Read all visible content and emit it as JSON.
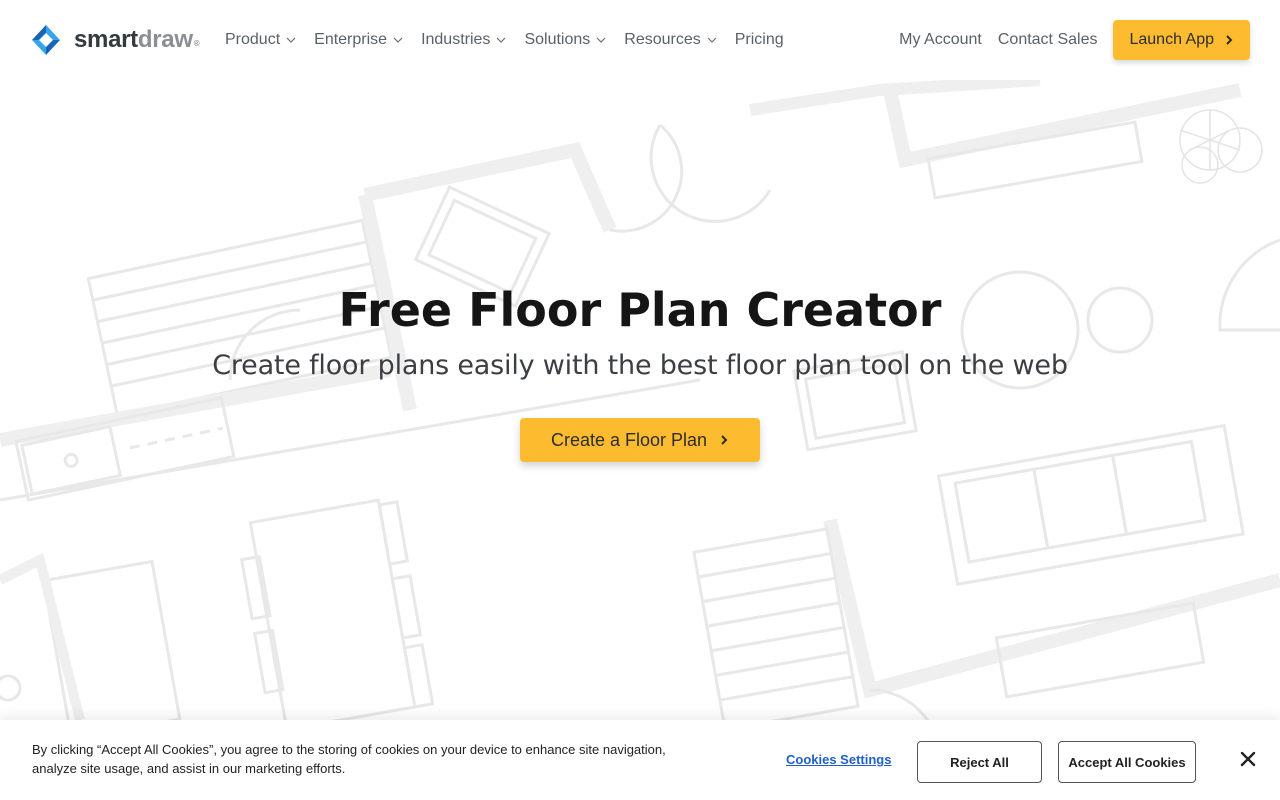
{
  "brand": {
    "name_part1": "smart",
    "name_part2": "draw",
    "trademark": "®",
    "colors": {
      "dark": "#333a40",
      "gray": "#8a8f94",
      "blue_light": "#34a6e8",
      "blue_dark": "#1764b8"
    }
  },
  "nav": {
    "items": [
      {
        "label": "Product",
        "has_dropdown": true
      },
      {
        "label": "Enterprise",
        "has_dropdown": true
      },
      {
        "label": "Industries",
        "has_dropdown": true
      },
      {
        "label": "Solutions",
        "has_dropdown": true
      },
      {
        "label": "Resources",
        "has_dropdown": true
      },
      {
        "label": "Pricing",
        "has_dropdown": false
      }
    ],
    "my_account": "My Account",
    "contact_sales": "Contact Sales",
    "launch_app": "Launch App"
  },
  "hero": {
    "title": "Free Floor Plan Creator",
    "subtitle": "Create floor plans easily with the best floor plan tool on the web",
    "cta": "Create a Floor Plan"
  },
  "cookie_banner": {
    "text": "By clicking “Accept All Cookies”, you agree to the storing of cookies on your device to enhance site navigation, analyze site usage, and assist in our marketing efforts.",
    "settings": "Cookies Settings",
    "reject": "Reject All",
    "accept": "Accept All Cookies"
  },
  "colors": {
    "accent": "#fdbb30",
    "link": "#2060c8",
    "bg_art": "#ececec"
  }
}
